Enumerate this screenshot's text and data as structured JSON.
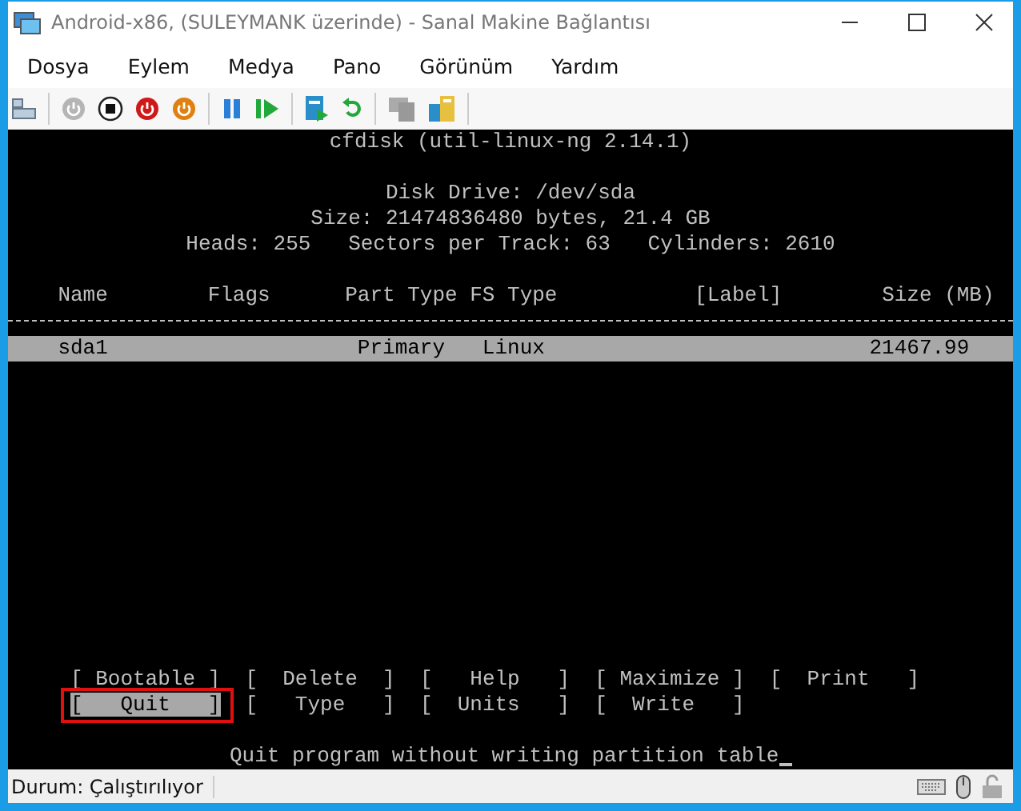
{
  "window": {
    "title": "Android-x86, (SULEYMANK üzerinde) - Sanal Makine Bağlantısı"
  },
  "menu": [
    "Dosya",
    "Eylem",
    "Medya",
    "Pano",
    "Görünüm",
    "Yardım"
  ],
  "terminal": {
    "program": "cfdisk (util-linux-ng 2.14.1)",
    "info": [
      "Disk Drive: /dev/sda",
      "Size: 21474836480 bytes, 21.4 GB",
      "Heads: 255   Sectors per Track: 63   Cylinders: 2610"
    ],
    "columns": [
      "Name",
      "Flags",
      "Part Type",
      "FS Type",
      "[Label]",
      "Size (MB)"
    ],
    "rows": [
      {
        "name": "sda1",
        "part_type": "Primary",
        "fs_type": "Linux",
        "size": "21467.99",
        "selected": true
      }
    ],
    "commands": [
      [
        {
          "label": "[ Bootable ]",
          "selected": false,
          "annotated": false
        },
        {
          "label": "[  Delete  ]",
          "selected": false,
          "annotated": false
        },
        {
          "label": "[   Help   ]",
          "selected": false,
          "annotated": false
        },
        {
          "label": "[ Maximize ]",
          "selected": false,
          "annotated": false
        },
        {
          "label": "[  Print   ]",
          "selected": false,
          "annotated": false
        }
      ],
      [
        {
          "label": "[   Quit   ]",
          "selected": true,
          "annotated": true
        },
        {
          "label": "[   Type   ]",
          "selected": false,
          "annotated": false
        },
        {
          "label": "[  Units   ]",
          "selected": false,
          "annotated": false
        },
        {
          "label": "[  Write   ]",
          "selected": false,
          "annotated": false
        }
      ]
    ],
    "message": "Quit program without writing partition table"
  },
  "status_bar": {
    "text": "Durum: Çalıştırılıyor"
  }
}
